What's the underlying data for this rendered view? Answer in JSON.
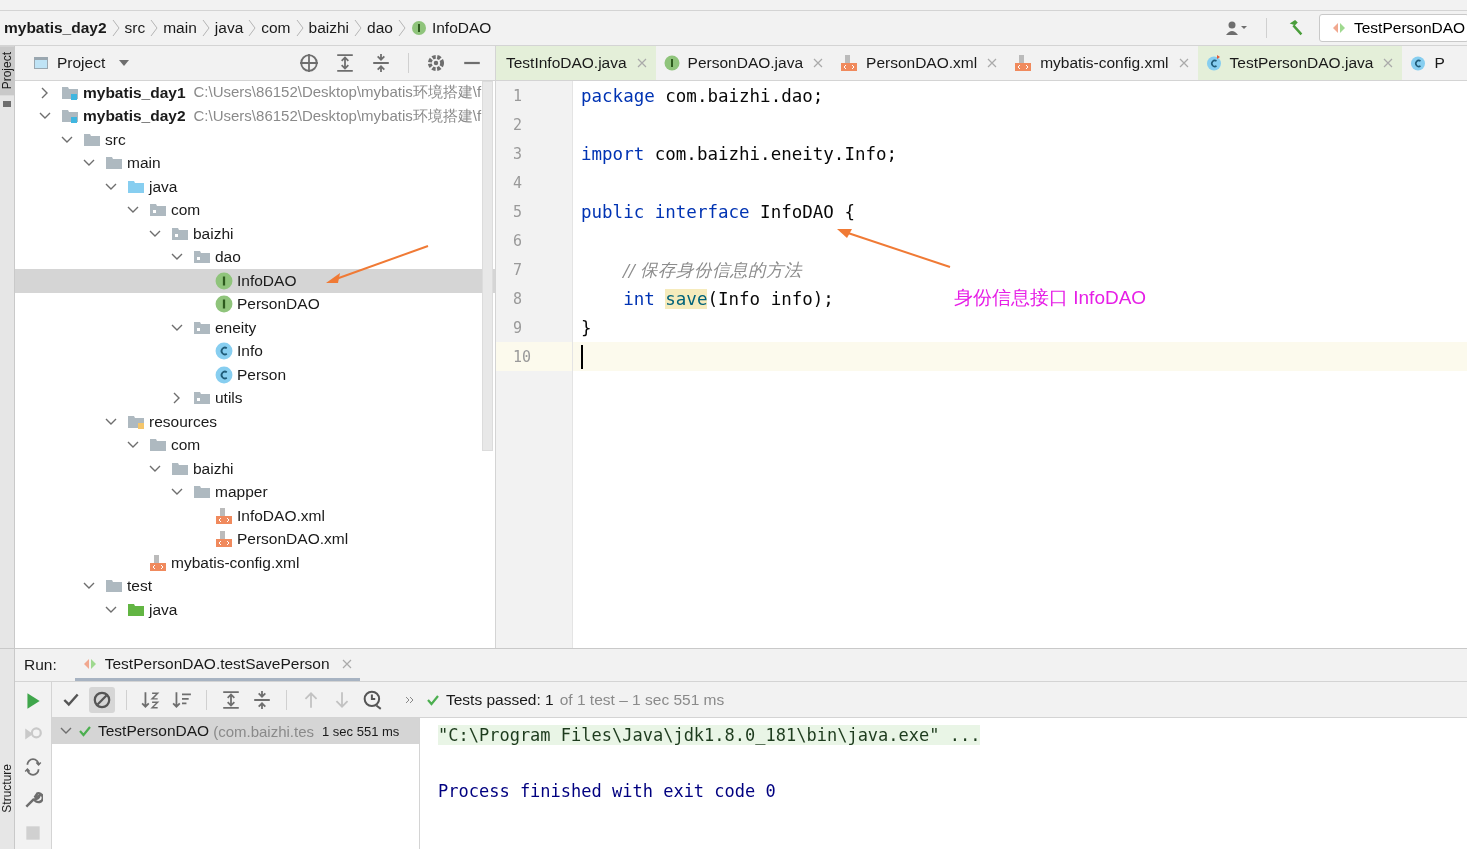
{
  "breadcrumb": [
    {
      "label": "mybatis_day2",
      "kind": "project"
    },
    {
      "label": "src",
      "kind": "folder"
    },
    {
      "label": "main",
      "kind": "folder"
    },
    {
      "label": "java",
      "kind": "folder"
    },
    {
      "label": "com",
      "kind": "folder"
    },
    {
      "label": "baizhi",
      "kind": "folder"
    },
    {
      "label": "dao",
      "kind": "folder"
    },
    {
      "label": "InfoDAO",
      "kind": "interface"
    }
  ],
  "run_config": "TestPersonDAO",
  "side_labels": [
    "Project",
    "Structure"
  ],
  "project_panel": {
    "title": "Project",
    "tree": [
      {
        "label": "mybatis_day1",
        "path": "C:\\Users\\86152\\Desktop\\mybatis环境搭建\\f",
        "kind": "module",
        "expanded": false,
        "selected": false
      },
      {
        "label": "mybatis_day2",
        "path": "C:\\Users\\86152\\Desktop\\mybatis环境搭建\\f",
        "kind": "module",
        "expanded": true,
        "selected": false,
        "children": [
          {
            "label": "src",
            "kind": "folder",
            "expanded": true,
            "selected": false,
            "children": [
              {
                "label": "main",
                "kind": "folder",
                "expanded": true,
                "selected": false,
                "children": [
                  {
                    "label": "java",
                    "kind": "source",
                    "expanded": true,
                    "selected": false,
                    "children": [
                      {
                        "label": "com",
                        "kind": "package",
                        "expanded": true,
                        "selected": false,
                        "children": [
                          {
                            "label": "baizhi",
                            "kind": "package",
                            "expanded": true,
                            "selected": false,
                            "children": [
                              {
                                "label": "dao",
                                "kind": "package",
                                "expanded": true,
                                "selected": false,
                                "children": [
                                  {
                                    "label": "InfoDAO",
                                    "kind": "interface",
                                    "selected": true
                                  },
                                  {
                                    "label": "PersonDAO",
                                    "kind": "interface",
                                    "selected": false
                                  }
                                ]
                              },
                              {
                                "label": "eneity",
                                "kind": "package",
                                "expanded": true,
                                "selected": false,
                                "children": [
                                  {
                                    "label": "Info",
                                    "kind": "class",
                                    "selected": false
                                  },
                                  {
                                    "label": "Person",
                                    "kind": "class",
                                    "selected": false
                                  }
                                ]
                              },
                              {
                                "label": "utils",
                                "kind": "package",
                                "expanded": false,
                                "selected": false
                              }
                            ]
                          }
                        ]
                      }
                    ]
                  },
                  {
                    "label": "resources",
                    "kind": "resources",
                    "expanded": true,
                    "selected": false,
                    "children": [
                      {
                        "label": "com",
                        "kind": "folder",
                        "expanded": true,
                        "selected": false,
                        "children": [
                          {
                            "label": "baizhi",
                            "kind": "folder",
                            "expanded": true,
                            "selected": false,
                            "children": [
                              {
                                "label": "mapper",
                                "kind": "folder",
                                "expanded": true,
                                "selected": false,
                                "children": [
                                  {
                                    "label": "InfoDAO.xml",
                                    "kind": "xml",
                                    "selected": false
                                  },
                                  {
                                    "label": "PersonDAO.xml",
                                    "kind": "xml",
                                    "selected": false
                                  }
                                ]
                              }
                            ]
                          }
                        ]
                      },
                      {
                        "label": "mybatis-config.xml",
                        "kind": "xml",
                        "selected": false
                      }
                    ]
                  }
                ]
              },
              {
                "label": "test",
                "kind": "folder",
                "expanded": true,
                "selected": false,
                "children": [
                  {
                    "label": "java",
                    "kind": "test-source",
                    "expanded": true,
                    "selected": false
                  }
                ]
              }
            ]
          }
        ]
      }
    ]
  },
  "editor_tabs": [
    {
      "label": "TestInfoDAO.java",
      "kind": "none",
      "test": true
    },
    {
      "label": "PersonDAO.java",
      "kind": "interface",
      "test": false
    },
    {
      "label": "PersonDAO.xml",
      "kind": "xml",
      "test": false
    },
    {
      "label": "mybatis-config.xml",
      "kind": "xml",
      "test": false
    },
    {
      "label": "TestPersonDAO.java",
      "kind": "test-class",
      "test": true
    },
    {
      "label": "P",
      "kind": "class",
      "test": false
    }
  ],
  "code_lines": [
    {
      "number": "1",
      "current": false,
      "tokens": [
        {
          "kind": "keyword",
          "text": "package"
        },
        {
          "kind": "plain",
          "text": " com.baizhi.dao;"
        }
      ]
    },
    {
      "number": "2",
      "current": false
    },
    {
      "number": "3",
      "current": false,
      "tokens": [
        {
          "kind": "keyword",
          "text": "import"
        },
        {
          "kind": "plain",
          "text": " com.baizhi.eneity.Info;"
        }
      ]
    },
    {
      "number": "4",
      "current": false
    },
    {
      "number": "5",
      "current": false,
      "tokens": [
        {
          "kind": "keyword",
          "text": "public interface"
        },
        {
          "kind": "plain",
          "text": " InfoDAO {"
        }
      ]
    },
    {
      "number": "6",
      "current": false
    },
    {
      "number": "7",
      "current": false,
      "indent": true,
      "tokens": [
        {
          "kind": "comment",
          "text": "// 保存身份信息的方法"
        }
      ]
    },
    {
      "number": "8",
      "current": false,
      "indent": true,
      "tokens": [
        {
          "kind": "keyword",
          "text": "int "
        },
        {
          "kind": "method",
          "text": "save"
        },
        {
          "kind": "plain",
          "text": "(Info info);"
        }
      ]
    },
    {
      "number": "9",
      "current": false,
      "tokens": [
        {
          "kind": "plain",
          "text": "}"
        }
      ]
    },
    {
      "number": "10",
      "current": true
    }
  ],
  "annotation": "身份信息接口 InfoDAO",
  "run_panel": {
    "label": "Run:",
    "tab": "TestPersonDAO.testSavePerson",
    "status_main": "Tests passed: 1",
    "status_rest": "of 1 test – 1 sec 551 ms",
    "test_row": {
      "name": "TestPersonDAO",
      "package": "(com.baizhi.tes",
      "time": "1 sec 551 ms",
      "passed": true
    },
    "console": [
      {
        "kind": "command",
        "text": "\"C:\\Program Files\\Java\\jdk1.8.0_181\\bin\\java.exe\" ..."
      },
      {
        "kind": "info",
        "text": "Process finished with exit code 0"
      }
    ]
  }
}
